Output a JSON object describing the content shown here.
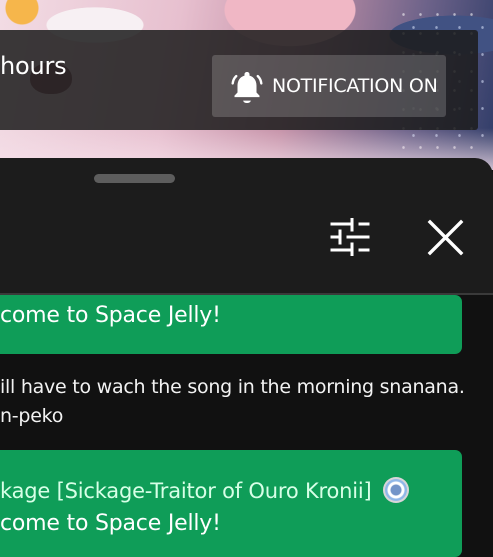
{
  "stream_notice": {
    "time_text": "hours",
    "notification_label": "NOTIFICATION ON"
  },
  "chat": {
    "messages": [
      {
        "text": "come to Space Jelly!"
      },
      {
        "line1": "ill have to wach the song in the morning snanana.",
        "line2": "n-peko"
      },
      {
        "author": "kage [Sickage-Traitor of Ouro Kronii]",
        "text": "come to Space Jelly!"
      }
    ]
  },
  "icons": {
    "bell": "notification-bell-icon",
    "settings": "settings-sliders-icon",
    "close": "close-icon",
    "member_badge": "member-badge-icon"
  },
  "colors": {
    "chat_bg": "#111111",
    "panel_bg": "#1c1c1c",
    "membership_green": "#0f9d58"
  }
}
